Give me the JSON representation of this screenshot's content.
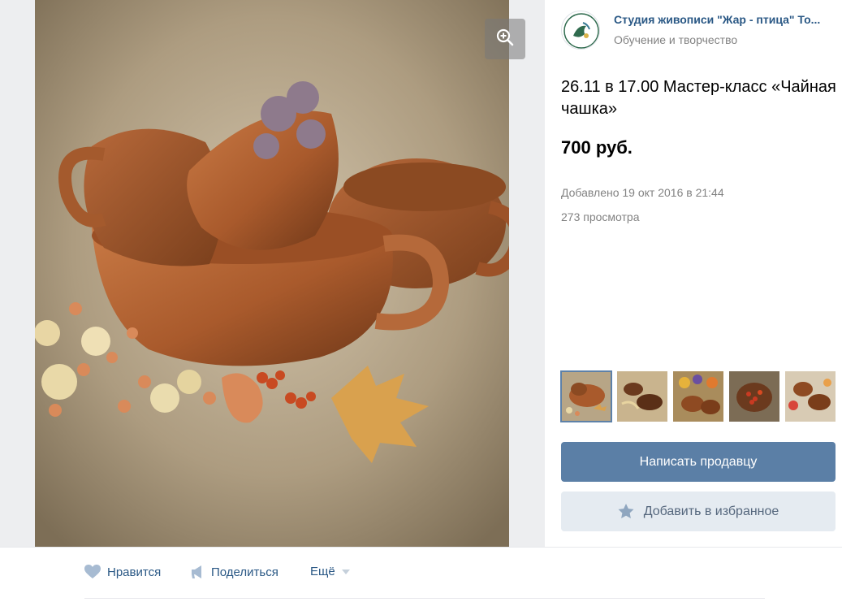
{
  "seller": {
    "name": "Студия живописи \"Жар - птица\" То...",
    "subtitle": "Обучение и творчество"
  },
  "product": {
    "title": "26.11 в 17.00 Мастер-класс «Чайная чашка»",
    "price": "700 руб.",
    "added": "Добавлено 19 окт 2016 в 21:44",
    "views": "273 просмотра"
  },
  "thumbnails": [
    {
      "label": "cups-on-burlap",
      "active": true
    },
    {
      "label": "cups-with-spoon",
      "active": false
    },
    {
      "label": "cups-with-flowers",
      "active": false
    },
    {
      "label": "bowl-with-berries",
      "active": false
    },
    {
      "label": "cups-with-roses",
      "active": false
    }
  ],
  "buttons": {
    "message_seller": "Написать продавцу",
    "add_favorite": "Добавить в избранное"
  },
  "actions": {
    "like": "Нравится",
    "share": "Поделиться",
    "more": "Ещё"
  },
  "icons": {
    "zoom": "zoom-in-icon",
    "like": "heart-icon",
    "share": "megaphone-icon",
    "more": "caret-down-icon",
    "favorite": "star-icon"
  },
  "colors": {
    "link": "#2a5885",
    "primary_button": "#5b7fa6",
    "secondary_button": "#e5ebf1",
    "muted_text": "#828282"
  }
}
